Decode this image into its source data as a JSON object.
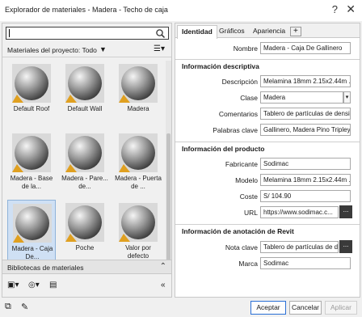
{
  "window": {
    "title": "Explorador de materiales - Madera - Techo de caja",
    "help": "?",
    "close": "✕"
  },
  "search": {
    "value": "",
    "icon": "search-icon"
  },
  "library_bar": {
    "label": "Materiales del proyecto: Todo",
    "filter_icon": "▼",
    "view_icon": "☰▾"
  },
  "materials": [
    {
      "name": "Default Roof"
    },
    {
      "name": "Default Wall"
    },
    {
      "name": "Madera"
    },
    {
      "name": "Madera - Base de la..."
    },
    {
      "name": "Madera - Pare... de..."
    },
    {
      "name": "Madera - Puerta de ..."
    },
    {
      "name": "Madera - Caja De...",
      "selected": true
    },
    {
      "name": "Poche"
    },
    {
      "name": "Valor por defecto"
    }
  ],
  "libraries_bar": {
    "label": "Bibliotecas de materiales",
    "chevron": "⌃"
  },
  "tabs": {
    "identity": "Identidad",
    "graphics": "Gráficos",
    "appearance": "Apariencia",
    "add": "+"
  },
  "identity": {
    "name_label": "Nombre",
    "name_value": "Madera - Caja De Gallinero",
    "desc_header": "Información descriptiva",
    "description_label": "Descripción",
    "description_value": "Melamina 18mm 2.15x2.44m ...",
    "class_label": "Clase",
    "class_value": "Madera",
    "comments_label": "Comentarios",
    "comments_value": "Tablero de partículas de densi...",
    "keywords_label": "Palabras clave",
    "keywords_value": "Gallinero, Madera Pino Tripley",
    "product_header": "Información del producto",
    "manufacturer_label": "Fabricante",
    "manufacturer_value": "Sodimac",
    "model_label": "Modelo",
    "model_value": "Melamina 18mm 2.15x2.44m ...",
    "cost_label": "Coste",
    "cost_value": "S/ 104.90",
    "url_label": "URL",
    "url_value": "https://www.sodimac.c...",
    "revit_header": "Información de anotación de Revit",
    "keynote_label": "Nota clave",
    "keynote_value": "Tablero de partículas de densi...",
    "mark_label": "Marca",
    "mark_value": "Sodimac",
    "more_button": "..."
  },
  "buttons": {
    "accept": "Aceptar",
    "cancel": "Cancelar",
    "apply": "Aplicar"
  },
  "colors": {
    "accent": "#2a6fd6",
    "selection": "#cfe0f4",
    "more_button": "#3a3a3a"
  }
}
